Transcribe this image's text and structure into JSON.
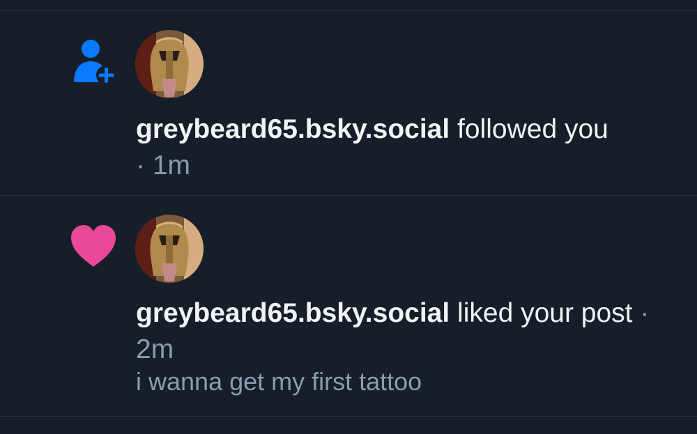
{
  "notifications": [
    {
      "type_icon": "person-plus-icon",
      "icon_color": "#0a7aff",
      "handle": "greybeard65.bsky.social",
      "action": "followed you",
      "separator": "·",
      "time": "1m"
    },
    {
      "type_icon": "heart-icon",
      "icon_color": "#ec4899",
      "handle": "greybeard65.bsky.social",
      "action": "liked your post",
      "separator": "·",
      "time": "2m",
      "post_preview": "i wanna get my first tattoo"
    }
  ]
}
